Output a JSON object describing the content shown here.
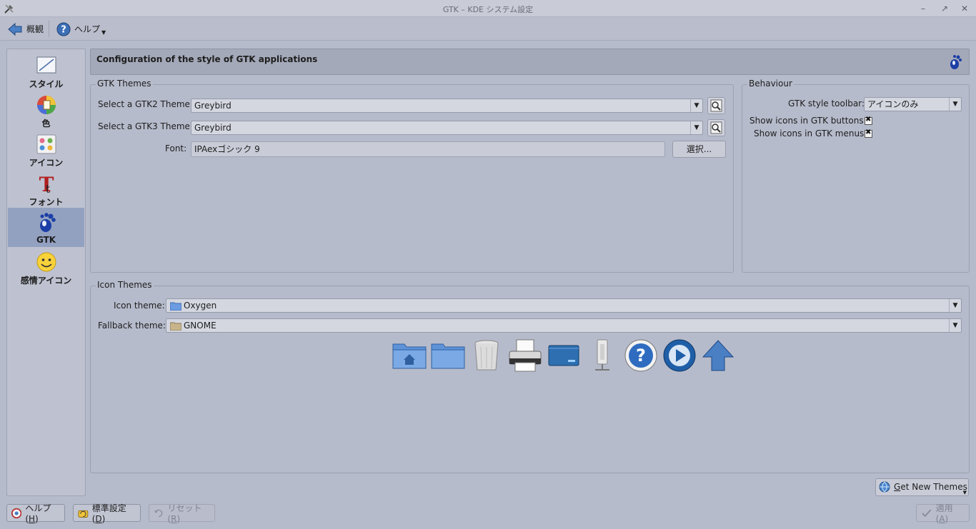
{
  "window": {
    "title": "GTK – KDE システム設定"
  },
  "toolbar": {
    "overview_label": "概観",
    "help_label": "ヘルプ"
  },
  "sidebar": {
    "items": [
      {
        "label": "スタイル"
      },
      {
        "label": "色"
      },
      {
        "label": "アイコン"
      },
      {
        "label": "フォント"
      },
      {
        "label": "GTK"
      },
      {
        "label": "感情アイコン"
      }
    ],
    "selected": "GTK"
  },
  "header": {
    "title": "Configuration of the style of GTK applications"
  },
  "gtk_themes": {
    "title": "GTK Themes",
    "gtk2_label": "Select a GTK2 Theme:",
    "gtk2_value": "Greybird",
    "gtk3_label": "Select a GTK3 Theme:",
    "gtk3_value": "Greybird",
    "font_label": "Font:",
    "font_value": "IPAexゴシック 9",
    "font_button": "選択..."
  },
  "behaviour": {
    "title": "Behaviour",
    "toolbar_label": "GTK style toolbar:",
    "toolbar_value": "アイコンのみ",
    "buttons_icons_label": "Show icons in GTK buttons:",
    "buttons_icons_checked": true,
    "menus_icons_label": "Show icons in GTK menus:",
    "menus_icons_checked": true
  },
  "icon_themes": {
    "title": "Icon Themes",
    "icon_theme_label": "Icon theme:",
    "icon_theme_value": "Oxygen",
    "fallback_label": "Fallback theme:",
    "fallback_value": "GNOME",
    "preview_icons": [
      "home-folder-icon",
      "folder-icon",
      "trash-icon",
      "printer-icon",
      "drive-icon",
      "usb-drive-icon",
      "help-icon",
      "media-play-icon",
      "go-up-icon"
    ]
  },
  "get_new_themes": {
    "prefix": "G",
    "rest": "et New Themes"
  },
  "bottom": {
    "help_label": "ヘルプ(",
    "help_key": "H",
    "defaults_label": "標準設定(",
    "defaults_key": "D",
    "reset_label": "リセット(",
    "reset_key": "R",
    "apply_label": "適用(",
    "apply_key": "A",
    "close_paren": ")"
  },
  "colors": {
    "background": "#b6bbcb",
    "selected": "#93a1c1",
    "header": "#a4a9b9"
  }
}
